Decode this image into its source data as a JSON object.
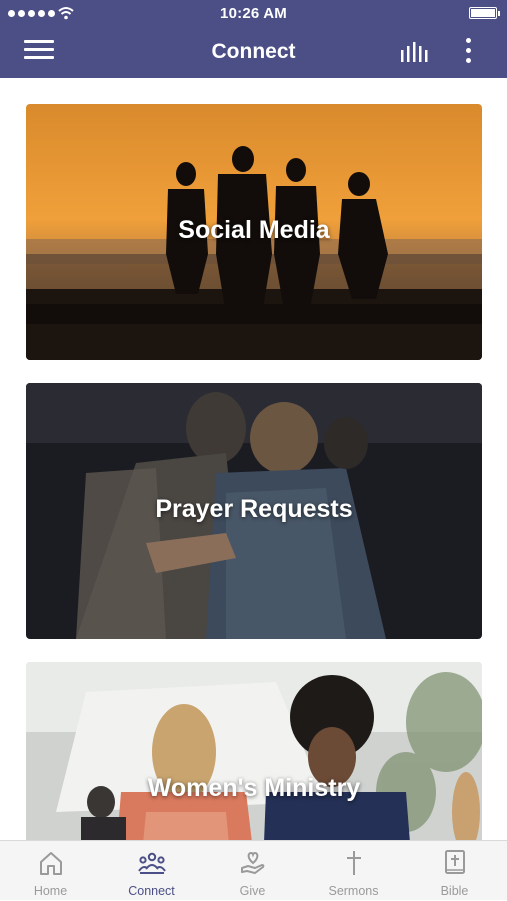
{
  "status_bar": {
    "time": "10:26 AM"
  },
  "nav": {
    "title": "Connect",
    "menu_icon": "hamburger-icon",
    "stats_icon": "bar-chart-icon",
    "more_icon": "vertical-ellipsis-icon"
  },
  "cards": [
    {
      "label": "Social Media",
      "image": "friends-silhouette-sunset"
    },
    {
      "label": "Prayer Requests",
      "image": "men-praying"
    },
    {
      "label": "Women's Ministry",
      "image": "women-outdoor-event"
    }
  ],
  "tabs": [
    {
      "label": "Home",
      "icon": "home-icon",
      "active": false
    },
    {
      "label": "Connect",
      "icon": "people-group-icon",
      "active": true
    },
    {
      "label": "Give",
      "icon": "hand-heart-icon",
      "active": false
    },
    {
      "label": "Sermons",
      "icon": "cross-icon",
      "active": false
    },
    {
      "label": "Bible",
      "icon": "bible-icon",
      "active": false
    }
  ],
  "colors": {
    "nav_bar": "#4b4f86",
    "active_tab": "#4b4f86",
    "inactive_tab": "#9a9a9a"
  }
}
